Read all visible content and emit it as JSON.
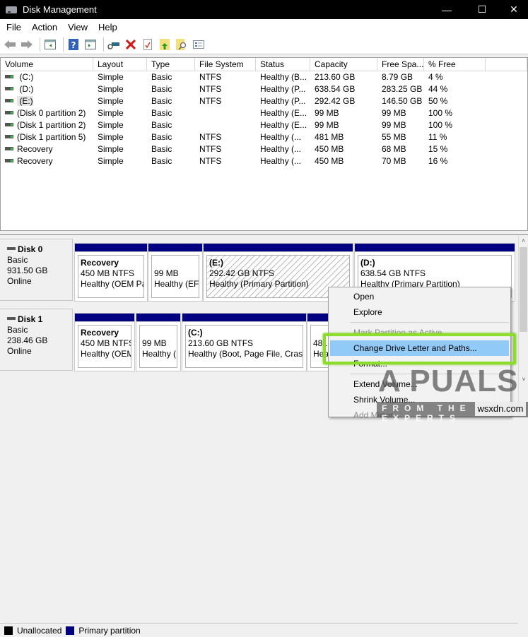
{
  "window": {
    "title": "Disk Management",
    "minimize_glyph": "—",
    "maximize_glyph": "☐",
    "close_glyph": "✕"
  },
  "menubar": [
    "File",
    "Action",
    "View",
    "Help"
  ],
  "toolbar": {
    "icons": [
      "back-arrow-icon",
      "forward-arrow-icon",
      "show-hide-console-tree-icon",
      "help-icon",
      "show-hide-action-pane-icon",
      "connect-disk-icon",
      "delete-icon",
      "properties-icon",
      "import-icon",
      "search-icon",
      "list-view-icon"
    ]
  },
  "volume_list": {
    "columns": [
      "Volume",
      "Layout",
      "Type",
      "File System",
      "Status",
      "Capacity",
      "Free Spa...",
      "% Free",
      ""
    ],
    "rows": [
      {
        "volume": " (C:)",
        "layout": "Simple",
        "type": "Basic",
        "fs": "NTFS",
        "status": "Healthy (B...",
        "capacity": "213.60 GB",
        "free": "8.79 GB",
        "pct": "4 %"
      },
      {
        "volume": " (D:)",
        "layout": "Simple",
        "type": "Basic",
        "fs": "NTFS",
        "status": "Healthy (P...",
        "capacity": "638.54 GB",
        "free": "283.25 GB",
        "pct": "44 %"
      },
      {
        "volume": " (E:)",
        "layout": "Simple",
        "type": "Basic",
        "fs": "NTFS",
        "status": "Healthy (P...",
        "capacity": "292.42 GB",
        "free": "146.50 GB",
        "pct": "50 %"
      },
      {
        "volume": "(Disk 0 partition 2)",
        "layout": "Simple",
        "type": "Basic",
        "fs": "",
        "status": "Healthy (E...",
        "capacity": "99 MB",
        "free": "99 MB",
        "pct": "100 %"
      },
      {
        "volume": "(Disk 1 partition 2)",
        "layout": "Simple",
        "type": "Basic",
        "fs": "",
        "status": "Healthy (E...",
        "capacity": "99 MB",
        "free": "99 MB",
        "pct": "100 %"
      },
      {
        "volume": "(Disk 1 partition 5)",
        "layout": "Simple",
        "type": "Basic",
        "fs": "NTFS",
        "status": "Healthy (...",
        "capacity": "481 MB",
        "free": "55 MB",
        "pct": "11 %"
      },
      {
        "volume": "Recovery",
        "layout": "Simple",
        "type": "Basic",
        "fs": "NTFS",
        "status": "Healthy (...",
        "capacity": "450 MB",
        "free": "68 MB",
        "pct": "15 %"
      },
      {
        "volume": "Recovery",
        "layout": "Simple",
        "type": "Basic",
        "fs": "NTFS",
        "status": "Healthy (...",
        "capacity": "450 MB",
        "free": "70 MB",
        "pct": "16 %"
      }
    ]
  },
  "disks": [
    {
      "name": "Disk 0",
      "type": "Basic",
      "size": "931.50 GB",
      "state": "Online",
      "partitions": [
        {
          "name": "Recovery",
          "size": "450 MB NTFS",
          "status": "Healthy (OEM Pa"
        },
        {
          "name": "",
          "size": "99 MB",
          "status": "Healthy (EFI"
        },
        {
          "name": " (E:)",
          "size": "292.42 GB NTFS",
          "status": "Healthy (Primary Partition)",
          "selected": true
        },
        {
          "name": " (D:)",
          "size": "638.54 GB NTFS",
          "status": "Healthy (Primary Partition)"
        }
      ]
    },
    {
      "name": "Disk 1",
      "type": "Basic",
      "size": "238.46 GB",
      "state": "Online",
      "partitions": [
        {
          "name": "Recovery",
          "size": "450 MB NTFS",
          "status": "Healthy (OEM"
        },
        {
          "name": "",
          "size": "99 MB",
          "status": "Healthy ("
        },
        {
          "name": " (C:)",
          "size": "213.60 GB NTFS",
          "status": "Healthy (Boot, Page File, Crash"
        },
        {
          "name": "",
          "size": "481 MB",
          "status": "Heal"
        }
      ]
    }
  ],
  "legend": [
    {
      "label": "Unallocated",
      "color": "#000000"
    },
    {
      "label": "Primary partition",
      "color": "#000080"
    }
  ],
  "context_menu": {
    "items": [
      {
        "label": "Open",
        "disabled": false
      },
      {
        "label": "Explore",
        "disabled": false
      },
      {
        "separator": true
      },
      {
        "label": "Mark Partition as Active",
        "disabled": true
      },
      {
        "label": "Change Drive Letter and Paths...",
        "disabled": false,
        "highlighted": true
      },
      {
        "label": "Format...",
        "disabled": false
      },
      {
        "separator": true
      },
      {
        "label": "Extend Volume...",
        "disabled": false
      },
      {
        "label": "Shrink Volume...",
        "disabled": false
      },
      {
        "label": "Add Mirror...",
        "disabled": true
      }
    ]
  },
  "watermark": {
    "brand": "A PUALS",
    "tagline": "FROM THE EXPERTS",
    "site": "wsxdn.com"
  },
  "colors": {
    "primary_partition": "#000080",
    "highlight_box": "#8cdc2c",
    "menu_hover": "#91c9f7"
  }
}
